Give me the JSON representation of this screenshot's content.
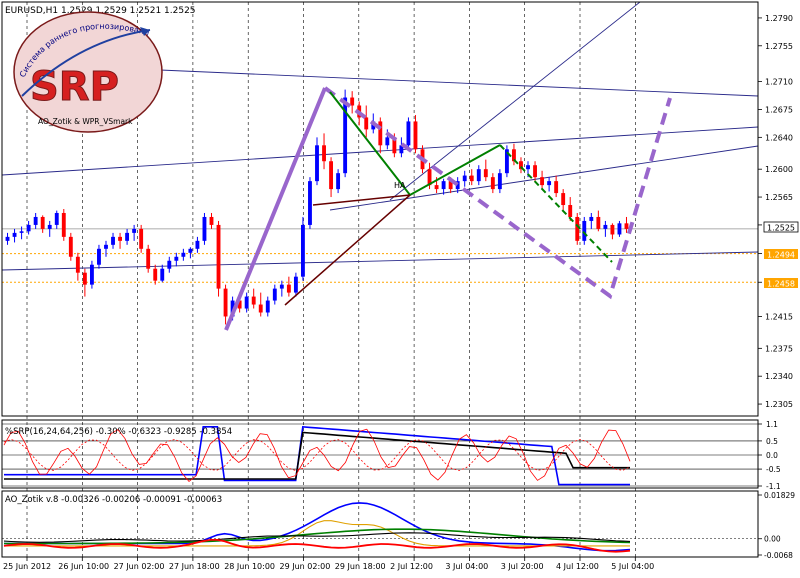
{
  "header": {
    "symbol_label": "EURUSD,H1  1.2529 1.2529 1.2521 1.2525"
  },
  "logo": {
    "letters": "SRP",
    "arc_text": "Система раннего прогнозирования",
    "bottom_text": "AO_Zotik & WPR_VSmark"
  },
  "badges": {
    "current": "1.2525",
    "level_a": "1.2494",
    "level_b": "1.2458"
  },
  "annotation": {
    "text": "HA"
  },
  "indicator1": {
    "label": "%SRP(16,24,64,256) -0.30% -0.6323 -0.9285 -0.3854",
    "ticks": [
      "1.1",
      "0.5",
      "0.0",
      "-0.5",
      "-1.1"
    ],
    "levels": [
      1.1,
      0.5,
      0.0,
      -0.5,
      -1.1
    ]
  },
  "indicator2": {
    "label": "AO_Zotik v.8 -0.00326 -0.00206 -0.00091 -0.00063",
    "ticks": [
      "0.01829",
      "0.00",
      "-0.0068"
    ]
  },
  "colors": {
    "bull": "#0000ff",
    "bear": "#ff0000",
    "pattern": "#9966cc",
    "green_line": "#008000",
    "maroon_line": "#660000",
    "trend_line": "#2a2a8a",
    "level_line": "#ffa500",
    "grid": "#000000"
  },
  "chart_data": {
    "type": "candlestick",
    "symbol": "EURUSD",
    "timeframe": "H1",
    "price_range": [
      1.229,
      1.281
    ],
    "price_ticks": [
      "1.2790",
      "1.2755",
      "1.2710",
      "1.2675",
      "1.2640",
      "1.2600",
      "1.2565",
      "1.2530",
      "1.2494",
      "1.2458",
      "1.2415",
      "1.2375",
      "1.2340",
      "1.2305"
    ],
    "time_labels": [
      "25 Jun 2012",
      "26 Jun 10:00",
      "27 Jun 02:00",
      "27 Jun 18:00",
      "28 Jun 10:00",
      "29 Jun 02:00",
      "29 Jun 18:00",
      "2 Jul 12:00",
      "3 Jul 04:00",
      "3 Jul 20:00",
      "4 Jul 12:00",
      "5 Jul 04:00"
    ],
    "levels": [
      1.2525,
      1.2494,
      1.2458
    ],
    "bars": [
      [
        1.251,
        1.252,
        1.2505,
        1.2515
      ],
      [
        1.2515,
        1.2525,
        1.2508,
        1.252
      ],
      [
        1.252,
        1.2528,
        1.2512,
        1.2522
      ],
      [
        1.2522,
        1.2535,
        1.2518,
        1.253
      ],
      [
        1.253,
        1.2545,
        1.2525,
        1.254
      ],
      [
        1.254,
        1.2542,
        1.252,
        1.2525
      ],
      [
        1.2525,
        1.2535,
        1.2515,
        1.253
      ],
      [
        1.253,
        1.2548,
        1.2525,
        1.2545
      ],
      [
        1.2545,
        1.255,
        1.251,
        1.2515
      ],
      [
        1.2515,
        1.252,
        1.2485,
        1.249
      ],
      [
        1.249,
        1.2495,
        1.246,
        1.247
      ],
      [
        1.247,
        1.2475,
        1.244,
        1.2455
      ],
      [
        1.2455,
        1.2485,
        1.245,
        1.248
      ],
      [
        1.248,
        1.2505,
        1.2475,
        1.25
      ],
      [
        1.25,
        1.251,
        1.249,
        1.2505
      ],
      [
        1.2505,
        1.252,
        1.25,
        1.2515
      ],
      [
        1.2515,
        1.252,
        1.25,
        1.251
      ],
      [
        1.251,
        1.2525,
        1.2505,
        1.252
      ],
      [
        1.252,
        1.253,
        1.251,
        1.2525
      ],
      [
        1.2525,
        1.253,
        1.2495,
        1.25
      ],
      [
        1.25,
        1.2505,
        1.247,
        1.2475
      ],
      [
        1.2475,
        1.248,
        1.2455,
        1.246
      ],
      [
        1.246,
        1.248,
        1.2458,
        1.2475
      ],
      [
        1.2475,
        1.249,
        1.247,
        1.2485
      ],
      [
        1.2485,
        1.2495,
        1.2478,
        1.249
      ],
      [
        1.249,
        1.25,
        1.2485,
        1.2495
      ],
      [
        1.2495,
        1.2502,
        1.2488,
        1.25
      ],
      [
        1.25,
        1.2515,
        1.2495,
        1.251
      ],
      [
        1.251,
        1.2545,
        1.2505,
        1.254
      ],
      [
        1.254,
        1.2545,
        1.2525,
        1.253
      ],
      [
        1.253,
        1.2535,
        1.244,
        1.245
      ],
      [
        1.245,
        1.2455,
        1.2405,
        1.2415
      ],
      [
        1.2415,
        1.244,
        1.241,
        1.2435
      ],
      [
        1.2435,
        1.2445,
        1.242,
        1.2425
      ],
      [
        1.2425,
        1.2445,
        1.242,
        1.244
      ],
      [
        1.244,
        1.245,
        1.2425,
        1.243
      ],
      [
        1.243,
        1.2445,
        1.2415,
        1.242
      ],
      [
        1.242,
        1.244,
        1.2415,
        1.2435
      ],
      [
        1.2435,
        1.2455,
        1.243,
        1.245
      ],
      [
        1.245,
        1.246,
        1.244,
        1.2455
      ],
      [
        1.2455,
        1.2465,
        1.244,
        1.2445
      ],
      [
        1.2445,
        1.247,
        1.244,
        1.2465
      ],
      [
        1.2465,
        1.254,
        1.246,
        1.253
      ],
      [
        1.253,
        1.259,
        1.2525,
        1.2585
      ],
      [
        1.2585,
        1.264,
        1.258,
        1.263
      ],
      [
        1.263,
        1.2645,
        1.26,
        1.261
      ],
      [
        1.261,
        1.2615,
        1.2565,
        1.2575
      ],
      [
        1.2575,
        1.26,
        1.257,
        1.2595
      ],
      [
        1.2595,
        1.27,
        1.259,
        1.269
      ],
      [
        1.269,
        1.2698,
        1.267,
        1.268
      ],
      [
        1.268,
        1.2685,
        1.2655,
        1.2665
      ],
      [
        1.2665,
        1.268,
        1.264,
        1.265
      ],
      [
        1.265,
        1.267,
        1.2645,
        1.266
      ],
      [
        1.266,
        1.2665,
        1.262,
        1.263
      ],
      [
        1.263,
        1.265,
        1.2625,
        1.264
      ],
      [
        1.264,
        1.2645,
        1.2615,
        1.262
      ],
      [
        1.262,
        1.264,
        1.2615,
        1.263
      ],
      [
        1.263,
        1.2665,
        1.2625,
        1.266
      ],
      [
        1.266,
        1.2668,
        1.262,
        1.2625
      ],
      [
        1.2625,
        1.263,
        1.2595,
        1.26
      ],
      [
        1.26,
        1.2608,
        1.2575,
        1.258
      ],
      [
        1.258,
        1.259,
        1.257,
        1.2575
      ],
      [
        1.2575,
        1.2588,
        1.2568,
        1.2585
      ],
      [
        1.2585,
        1.259,
        1.257,
        1.2575
      ],
      [
        1.2575,
        1.259,
        1.257,
        1.2585
      ],
      [
        1.2585,
        1.2598,
        1.2578,
        1.2592
      ],
      [
        1.2592,
        1.26,
        1.258,
        1.2585
      ],
      [
        1.2585,
        1.2605,
        1.258,
        1.26
      ],
      [
        1.26,
        1.2612,
        1.2585,
        1.259
      ],
      [
        1.259,
        1.2595,
        1.257,
        1.2575
      ],
      [
        1.2575,
        1.26,
        1.257,
        1.2595
      ],
      [
        1.2595,
        1.263,
        1.259,
        1.2625
      ],
      [
        1.2625,
        1.2632,
        1.2605,
        1.261
      ],
      [
        1.261,
        1.2615,
        1.2595,
        1.26
      ],
      [
        1.26,
        1.261,
        1.259,
        1.2605
      ],
      [
        1.2605,
        1.261,
        1.2585,
        1.259
      ],
      [
        1.259,
        1.2598,
        1.2575,
        1.258
      ],
      [
        1.258,
        1.259,
        1.2572,
        1.2585
      ],
      [
        1.2585,
        1.2592,
        1.2565,
        1.257
      ],
      [
        1.257,
        1.2575,
        1.2548,
        1.2555
      ],
      [
        1.2555,
        1.2565,
        1.2535,
        1.254
      ],
      [
        1.254,
        1.2545,
        1.2505,
        1.251
      ],
      [
        1.251,
        1.254,
        1.2505,
        1.2535
      ],
      [
        1.2535,
        1.2545,
        1.2525,
        1.254
      ],
      [
        1.254,
        1.2548,
        1.2522,
        1.2525
      ],
      [
        1.2525,
        1.2535,
        1.2515,
        1.253
      ],
      [
        1.253,
        1.2532,
        1.2512,
        1.2518
      ],
      [
        1.2518,
        1.2535,
        1.2515,
        1.2532
      ],
      [
        1.2532,
        1.254,
        1.252,
        1.2525
      ]
    ]
  }
}
